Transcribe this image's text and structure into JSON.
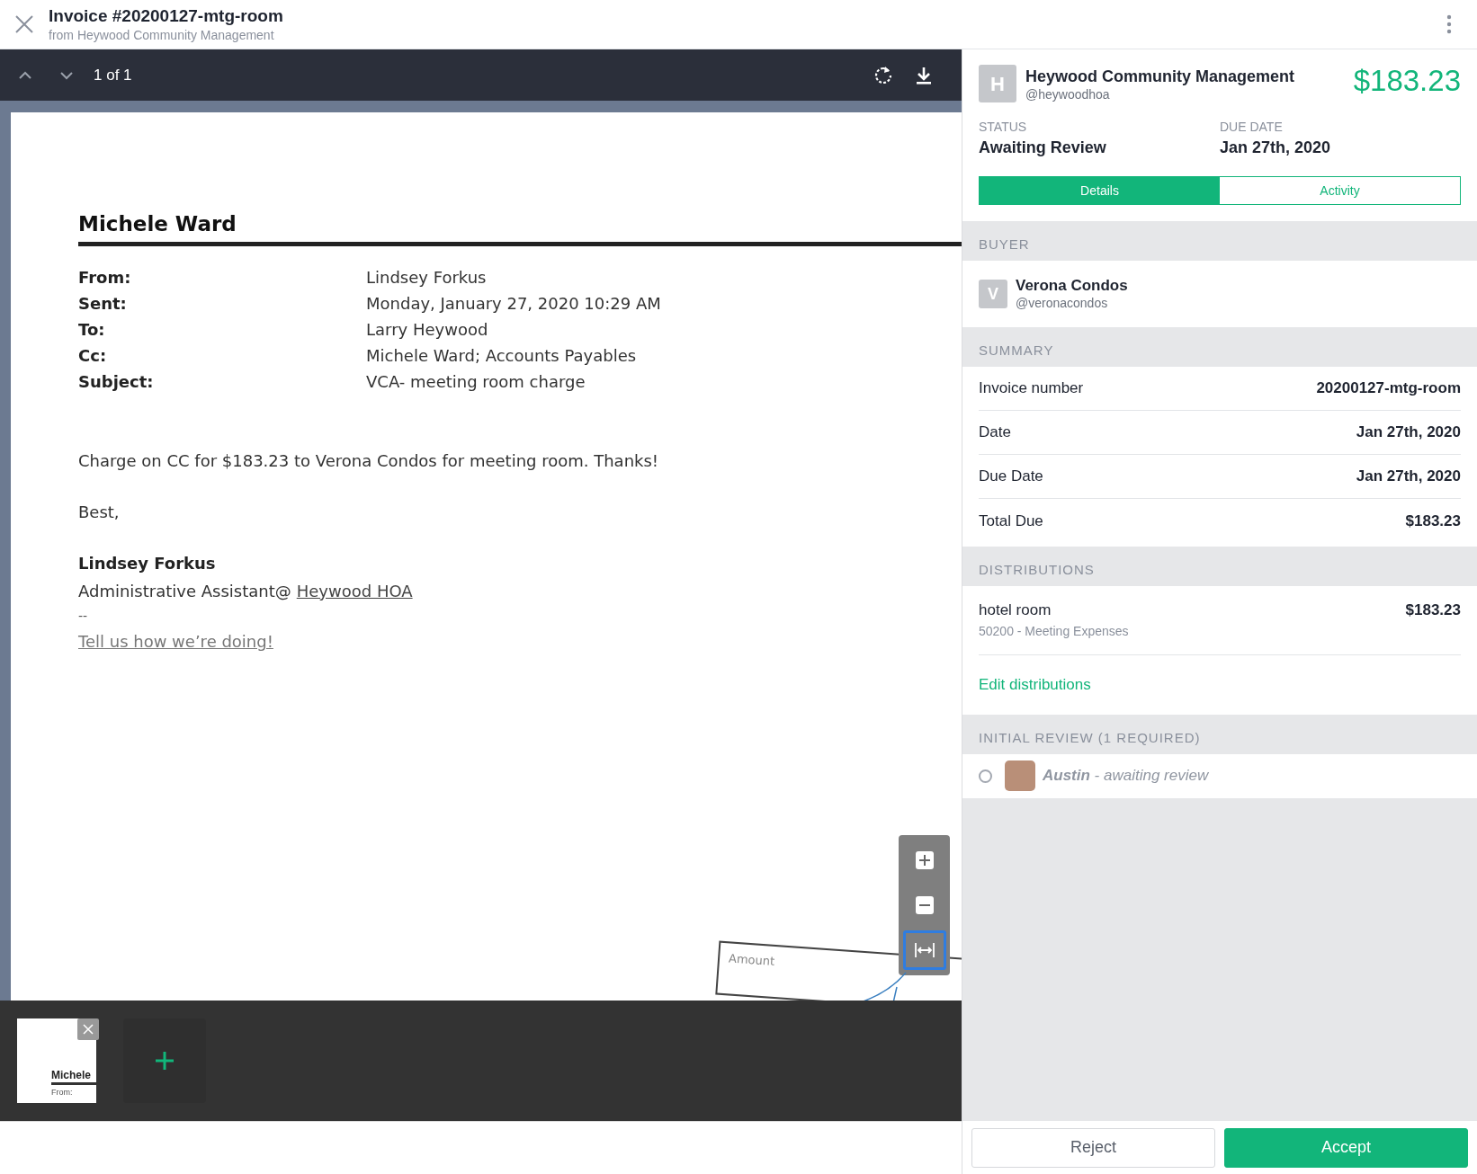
{
  "header": {
    "title": "Invoice #20200127-mtg-room",
    "subtitle": "from Heywood Community Management"
  },
  "viewer": {
    "page_indicator": "1 of 1",
    "document": {
      "heading": "Michele Ward",
      "fields": [
        {
          "label": "From:",
          "value": "Lindsey Forkus"
        },
        {
          "label": "Sent:",
          "value": "Monday, January 27, 2020 10:29 AM"
        },
        {
          "label": "To:",
          "value": "Larry Heywood"
        },
        {
          "label": "Cc:",
          "value": "Michele Ward; Accounts Payables"
        },
        {
          "label": "Subject:",
          "value": "VCA- meeting room charge"
        }
      ],
      "body": "Charge on CC for $183.23 to Verona Condos for meeting room. Thanks!",
      "closing": "Best,",
      "signature_name": "Lindsey Forkus",
      "signature_title": "Administrative Assistant@",
      "signature_link": "Heywood HOA",
      "separator": "--",
      "feedback_link": "Tell us how we’re doing!",
      "stamp_text": "Amount"
    },
    "zoom_controls": [
      {
        "kind": "zoom_in",
        "selected": false
      },
      {
        "kind": "zoom_out",
        "selected": false
      },
      {
        "kind": "fit_width",
        "selected": true
      }
    ],
    "thumbnails": [
      {
        "heading": "Michele",
        "line": "From:"
      }
    ]
  },
  "vendor": {
    "initial": "H",
    "name": "Heywood Community Management",
    "handle": "@heywoodhoa",
    "amount": "$183.23"
  },
  "status": {
    "label": "STATUS",
    "value": "Awaiting Review"
  },
  "due_date": {
    "label": "DUE DATE",
    "value": "Jan 27th, 2020"
  },
  "tabs": [
    {
      "label": "Details",
      "selected": true
    },
    {
      "label": "Activity",
      "selected": false
    }
  ],
  "buyer": {
    "heading": "BUYER",
    "initial": "V",
    "name": "Verona Condos",
    "handle": "@veronacondos"
  },
  "summary": {
    "heading": "SUMMARY",
    "rows": [
      {
        "label": "Invoice number",
        "value": "20200127-mtg-room"
      },
      {
        "label": "Date",
        "value": "Jan 27th, 2020"
      },
      {
        "label": "Due Date",
        "value": "Jan 27th, 2020"
      },
      {
        "label": "Total Due",
        "value": "$183.23"
      }
    ]
  },
  "distributions": {
    "heading": "DISTRIBUTIONS",
    "items": [
      {
        "name": "hotel room",
        "account": "50200 - Meeting Expenses",
        "amount": "$183.23"
      }
    ],
    "edit_link": "Edit distributions"
  },
  "review": {
    "heading": "INITIAL REVIEW (1 REQUIRED)",
    "reviewers": [
      {
        "text": "**Austin** - awaiting review",
        "checked": false
      }
    ]
  },
  "actions": [
    {
      "label": "Reject",
      "kind": "secondary"
    },
    {
      "label": "Accept",
      "kind": "primary"
    }
  ]
}
